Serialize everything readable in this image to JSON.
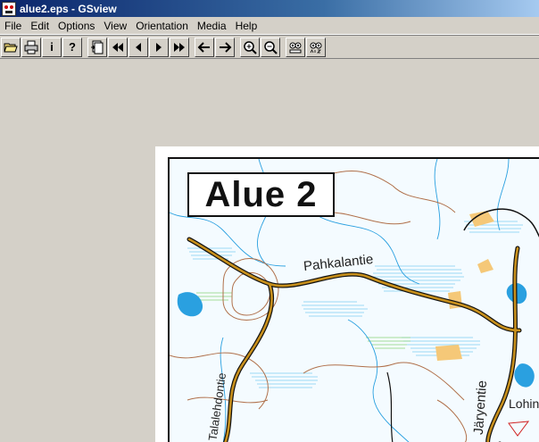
{
  "window": {
    "title": "alue2.eps - GSview"
  },
  "menu": [
    "File",
    "Edit",
    "Options",
    "View",
    "Orientation",
    "Media",
    "Help"
  ],
  "toolbar": [
    {
      "name": "open-button",
      "icon": "folder-open-icon"
    },
    {
      "name": "print-button",
      "icon": "printer-icon"
    },
    {
      "name": "info-button",
      "icon": "info-icon",
      "glyph": "i"
    },
    {
      "name": "help-button",
      "icon": "question-icon",
      "glyph": "?"
    },
    {
      "name": "goto-page-button",
      "icon": "page-list-icon"
    },
    {
      "name": "first-page-button",
      "icon": "skip-back-icon"
    },
    {
      "name": "prev-page-button",
      "icon": "prev-icon"
    },
    {
      "name": "next-page-button",
      "icon": "next-icon"
    },
    {
      "name": "last-page-button",
      "icon": "skip-forward-icon"
    },
    {
      "name": "back-button",
      "icon": "arrow-left-icon"
    },
    {
      "name": "forward-button",
      "icon": "arrow-right-icon"
    },
    {
      "name": "zoom-in-button",
      "icon": "zoom-in-icon"
    },
    {
      "name": "zoom-out-button",
      "icon": "zoom-out-icon"
    },
    {
      "name": "view-eye-button",
      "icon": "eye-icon"
    },
    {
      "name": "view-abc-button",
      "icon": "eye-abc-icon"
    }
  ],
  "map": {
    "area_label": "Alue 2",
    "road_pahkala": "Pahkalantie",
    "road_lehdon": "Talalehdontie",
    "road_jarv": "Järyentie",
    "place_lohi": "Lohin"
  },
  "colors": {
    "road": "#a87a1c",
    "contour": "#b0704a",
    "water": "#2aa0e0",
    "field": "#f5c878",
    "marsh": "#8cd6f5"
  }
}
